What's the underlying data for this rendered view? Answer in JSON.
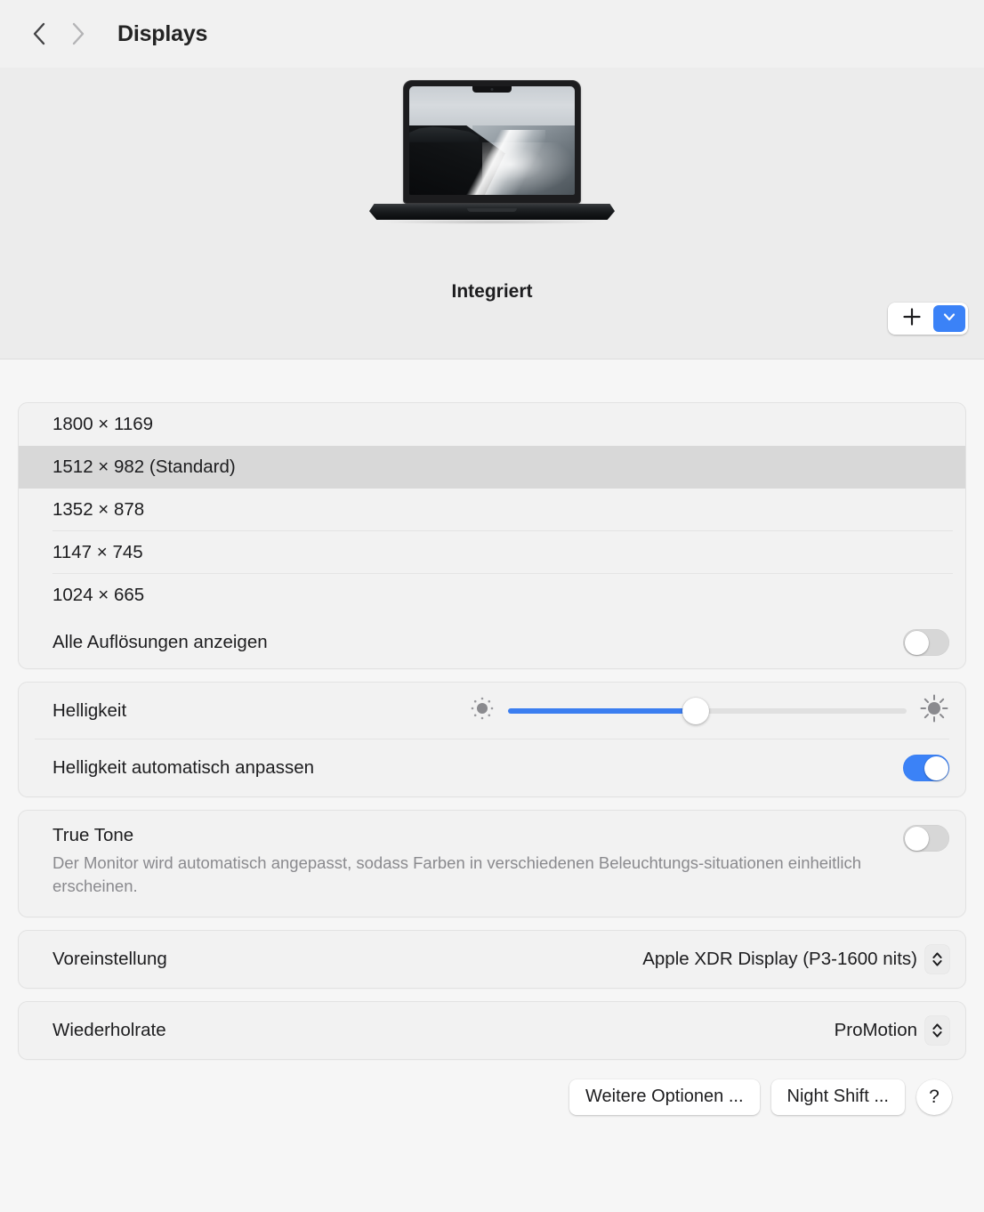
{
  "header": {
    "back_icon": "chevron-left-icon",
    "forward_icon": "chevron-right-icon",
    "title": "Displays"
  },
  "hero": {
    "display_label": "Integriert",
    "add_button_icon": "plus-icon",
    "popup_button_icon": "chevron-down-icon",
    "accent_color": "#3b82f7"
  },
  "resolutions": {
    "items": [
      {
        "label": "1800 × 1169",
        "selected": false
      },
      {
        "label": "1512 × 982 (Standard)",
        "selected": true
      },
      {
        "label": "1352 × 878",
        "selected": false
      },
      {
        "label": "1147 × 745",
        "selected": false
      },
      {
        "label": "1024 × 665",
        "selected": false
      }
    ],
    "show_all_label": "Alle Auflösungen anzeigen",
    "show_all_state": "off"
  },
  "brightness": {
    "label": "Helligkeit",
    "value_percent": 47,
    "low_icon": "brightness-low-icon",
    "high_icon": "brightness-high-icon",
    "auto_label": "Helligkeit automatisch anpassen",
    "auto_state": "on"
  },
  "true_tone": {
    "label": "True Tone",
    "state": "off",
    "description": "Der Monitor wird automatisch angepasst, sodass Farben in verschiedenen Beleuchtungs-situationen einheitlich erscheinen."
  },
  "preset": {
    "label": "Voreinstellung",
    "value": "Apple XDR Display (P3-1600 nits)",
    "stepper_icon": "chevron-up-down-icon"
  },
  "refresh_rate": {
    "label": "Wiederholrate",
    "value": "ProMotion",
    "stepper_icon": "chevron-up-down-icon"
  },
  "footer": {
    "more_options_label": "Weitere Optionen ...",
    "night_shift_label": "Night Shift ...",
    "help_label": "?"
  }
}
